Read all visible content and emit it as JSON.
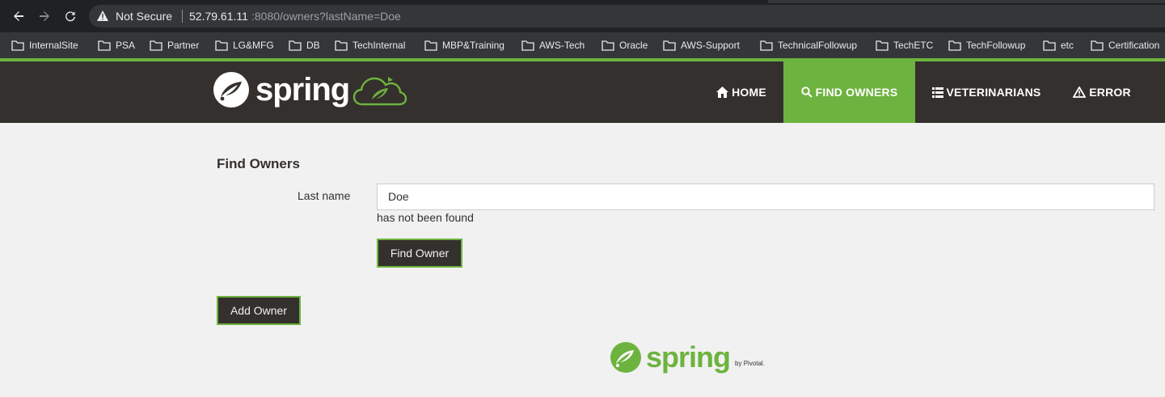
{
  "browser": {
    "security_label": "Not Secure",
    "url_host": "52.79.61.11",
    "url_path": ":8080/owners?lastName=Doe",
    "bookmarks": [
      {
        "label": "InternalSite"
      },
      {
        "label": "PSA"
      },
      {
        "label": "Partner"
      },
      {
        "label": "LG&MFG"
      },
      {
        "label": "DB"
      },
      {
        "label": "TechInternal"
      },
      {
        "label": "MBP&Training"
      },
      {
        "label": "AWS-Tech"
      },
      {
        "label": "Oracle"
      },
      {
        "label": "AWS-Support"
      },
      {
        "label": "TechnicalFollowup"
      },
      {
        "label": "TechETC"
      },
      {
        "label": "TechFollowup"
      },
      {
        "label": "etc"
      },
      {
        "label": "Certification"
      }
    ]
  },
  "header": {
    "logo_text": "spring",
    "nav": {
      "home": "HOME",
      "find_owners": "FIND OWNERS",
      "veterinarians": "VETERINARIANS",
      "error": "ERROR"
    }
  },
  "main": {
    "title": "Find Owners",
    "last_name_label": "Last name",
    "last_name_value": "Doe",
    "error_text": "has not been found",
    "find_button": "Find Owner",
    "add_button": "Add Owner"
  },
  "footer": {
    "logo_text": "spring",
    "by_text": "by Pivotal."
  },
  "colors": {
    "brand_green": "#6db33f",
    "brand_dark": "#34302d"
  }
}
